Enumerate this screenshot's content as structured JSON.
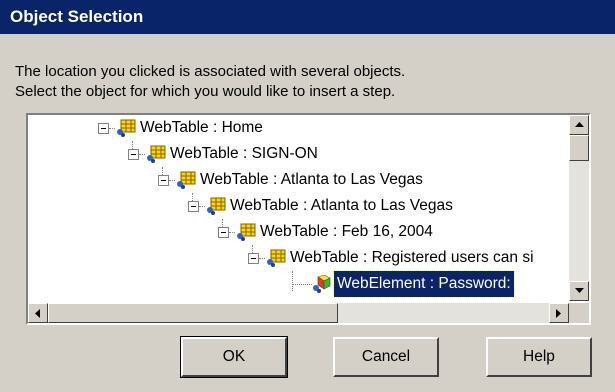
{
  "dialog": {
    "title": "Object Selection",
    "instructions": [
      "The location you clicked is associated with several objects.",
      "Select the object for which you would like to insert a step."
    ]
  },
  "tree": {
    "nodes": [
      {
        "label": "WebTable : Home",
        "icon": "webtable-icon",
        "expanded": true
      },
      {
        "label": "WebTable : SIGN-ON",
        "icon": "webtable-icon",
        "expanded": true
      },
      {
        "label": "WebTable : Atlanta to Las Vegas",
        "icon": "webtable-icon",
        "expanded": true
      },
      {
        "label": "WebTable : Atlanta to Las Vegas",
        "icon": "webtable-icon",
        "expanded": true
      },
      {
        "label": "WebTable : Feb 16, 2004",
        "icon": "webtable-icon",
        "expanded": true
      },
      {
        "label": "WebTable : Registered users can si",
        "icon": "webtable-icon",
        "expanded": true
      },
      {
        "label": "WebElement : Password:",
        "icon": "webelement-icon",
        "selected": true
      }
    ]
  },
  "buttons": {
    "ok": "OK",
    "cancel": "Cancel",
    "help": "Help"
  },
  "colors": {
    "titlebar": "#0a246a",
    "selection": "#0a246a",
    "face": "#d4d0c8"
  }
}
